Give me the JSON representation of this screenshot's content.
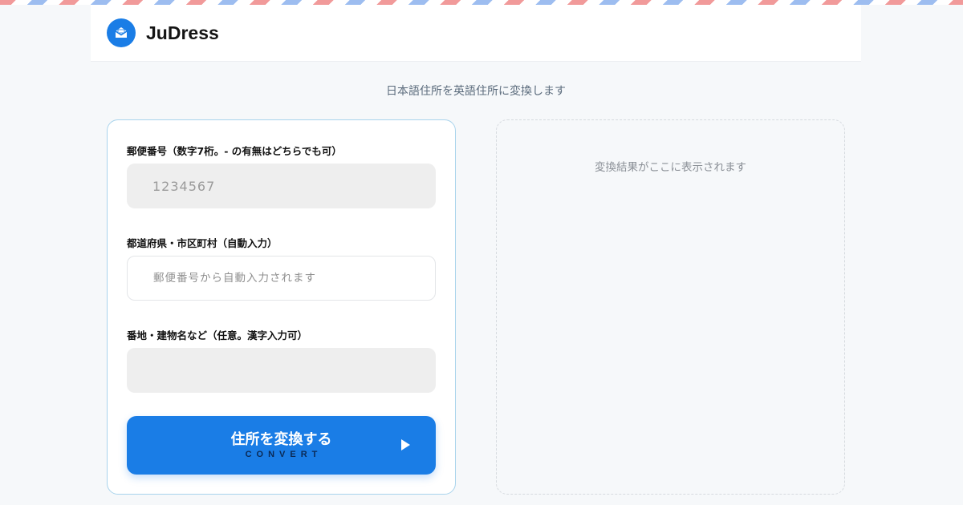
{
  "app": {
    "name": "JuDress",
    "logo_icon": "mail-envelope-icon",
    "subtitle": "日本語住所を英語住所に変換します"
  },
  "form": {
    "postal": {
      "label": "郵便番号（数字7桁。- の有無はどちらでも可）",
      "value": "",
      "placeholder": "1234567"
    },
    "prefecture_city": {
      "label": "都道府県・市区町村（自動入力）",
      "value": "",
      "placeholder": "郵便番号から自動入力されます"
    },
    "street": {
      "label": "番地・建物名など（任意。漢字入力可）",
      "value": "",
      "placeholder": ""
    },
    "convert_button": {
      "label": "住所を変換する",
      "sublabel": "CONVERT",
      "icon": "play-arrow-icon"
    }
  },
  "result": {
    "placeholder": "変換結果がここに表示されます"
  },
  "colors": {
    "accent": "#1a7de6",
    "background": "#f6f8fa",
    "stripe_red": "#f19a9a",
    "stripe_blue": "#9dbdf0"
  }
}
